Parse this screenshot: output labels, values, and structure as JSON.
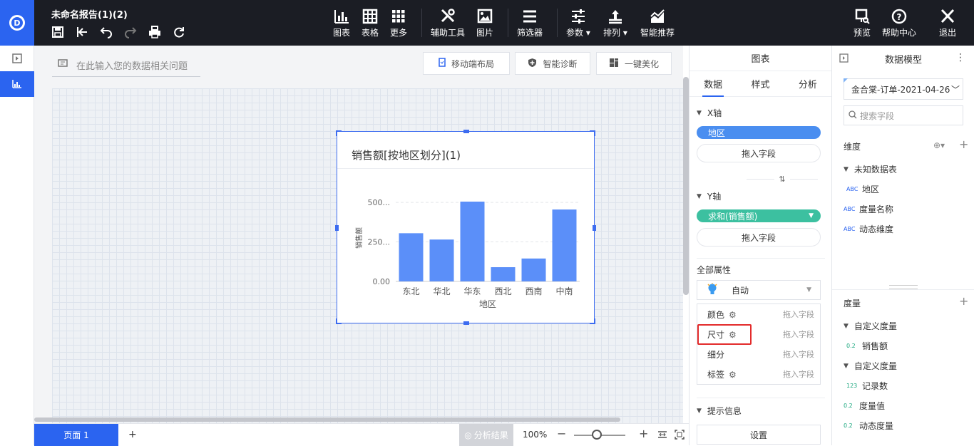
{
  "header": {
    "report_title": "未命名报告(1)(2)",
    "tools": [
      {
        "label": "图表",
        "icon": "bar-chart-icon"
      },
      {
        "label": "表格",
        "icon": "table-icon"
      },
      {
        "label": "更多",
        "icon": "grid-more-icon"
      },
      {
        "label": "辅助工具",
        "icon": "tools-icon"
      },
      {
        "label": "图片",
        "icon": "image-icon"
      },
      {
        "label": "筛选器",
        "icon": "filter-lines-icon"
      },
      {
        "label": "参数",
        "icon": "sliders-icon"
      },
      {
        "label": "排列",
        "icon": "arrange-icon"
      },
      {
        "label": "智能推荐",
        "icon": "trend-chart-icon"
      }
    ],
    "right_tools": [
      {
        "label": "预览",
        "icon": "preview-icon"
      },
      {
        "label": "帮助中心",
        "icon": "help-icon"
      },
      {
        "label": "退出",
        "icon": "close-icon"
      }
    ]
  },
  "canvas": {
    "query_placeholder": "在此输入您的数据相关问题",
    "top_buttons": [
      "移动端布局",
      "智能诊断",
      "一键美化"
    ]
  },
  "widget": {
    "title": "销售额[按地区划分](1)"
  },
  "chart_data": {
    "type": "bar",
    "categories": [
      "东北",
      "华北",
      "华东",
      "西北",
      "西南",
      "中南"
    ],
    "values": [
      305,
      265,
      505,
      90,
      145,
      455
    ],
    "ylabel": "销售额",
    "xlabel": "地区",
    "ylim": [
      0,
      550
    ],
    "ytick_labels": [
      "0.00",
      "250...",
      "500..."
    ],
    "ytick_values": [
      0,
      250,
      500
    ],
    "bar_color": "#5b8ff9"
  },
  "bottom": {
    "page_tab": "页面 1",
    "add": "+",
    "analysis": "分析结果",
    "zoom": "100%",
    "zoom_fraction": 0.45
  },
  "panel": {
    "title": "图表",
    "tabs": [
      "数据",
      "样式",
      "分析"
    ],
    "x_axis": {
      "label": "X轴",
      "field": "地区",
      "drop": "拖入字段",
      "field_color": "#4a8ef0"
    },
    "y_axis": {
      "label": "Y轴",
      "field": "求和(销售额)",
      "drop": "拖入字段",
      "field_color": "#3cc0a0"
    },
    "all_props": "全部属性",
    "auto": "自动",
    "props": [
      {
        "label": "颜色",
        "drop": "拖入字段"
      },
      {
        "label": "尺寸",
        "drop": "拖入字段"
      },
      {
        "label": "细分",
        "drop": "拖入字段"
      },
      {
        "label": "标签",
        "drop": "拖入字段"
      }
    ],
    "tooltip_section": "提示信息",
    "settings": "设置"
  },
  "model": {
    "title": "数据模型",
    "dataset": "金合棠-订单-2021-04-26",
    "search_placeholder": "搜索字段",
    "dimension_header": "维度",
    "dimension_group": "未知数据表",
    "dimensions": [
      {
        "badge": "ABC",
        "name": "地区"
      },
      {
        "badge": "ABC",
        "name": "度量名称"
      },
      {
        "badge": "ABC",
        "name": "动态维度"
      }
    ],
    "measure_header": "度量",
    "measure_groups": [
      {
        "name": "自定义度量",
        "items": [
          {
            "badge": "0.2",
            "name": "销售额"
          }
        ]
      },
      {
        "name": "自定义度量",
        "items": [
          {
            "badge": "123",
            "name": "记录数"
          },
          {
            "badge": "0.2",
            "name": "度量值"
          },
          {
            "badge": "0.2",
            "name": "动态度量"
          }
        ]
      }
    ]
  }
}
